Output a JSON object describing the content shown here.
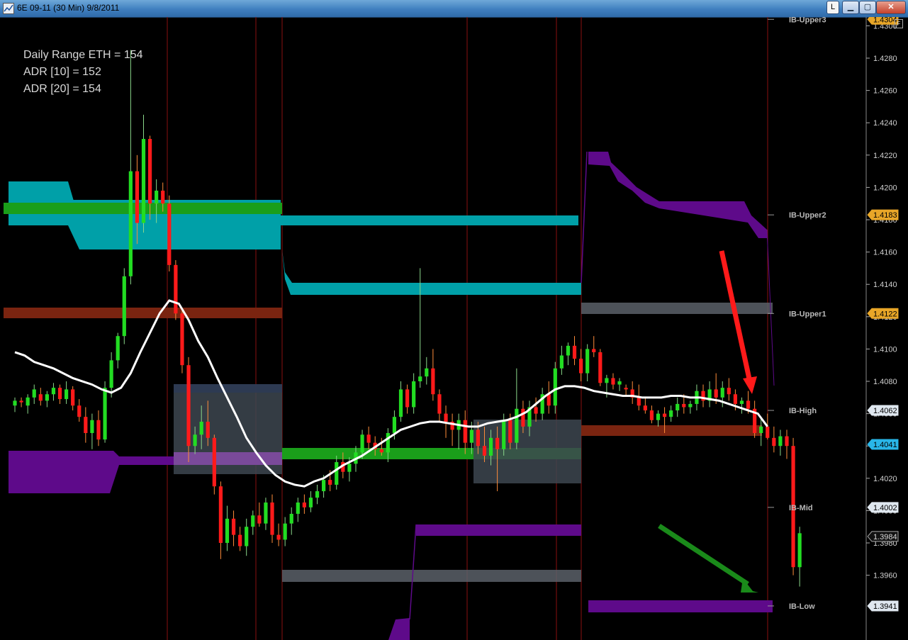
{
  "window": {
    "title": "6E 09-11 (30 Min)  9/8/2011",
    "buttons": {
      "l": "L",
      "minimize": "▁",
      "maximize": "▢",
      "close": "✕"
    },
    "corner_label": "F"
  },
  "stats": {
    "daily_range": "Daily Range ETH = 154",
    "adr10": "ADR [10] = 152",
    "adr20": "ADR [20] = 154"
  },
  "colors": {
    "up_candle": "#22dd22",
    "down_candle": "#ff1a1a",
    "moving_average": "#ffffff",
    "cyan_zone": "#00a0a8",
    "green_zone": "#1a9e1a",
    "brown_zone": "#7a2410",
    "purple_zone": "#5e0a8a",
    "gray_zone": "#5a6068",
    "session_divider": "#8a1010",
    "arrow_down": "#ff1a1a",
    "arrow_up": "#1a8a1a",
    "price_tag_orange": "#e8a628",
    "price_tag_cyan": "#29b6e8",
    "price_tag_white": "#dfe7ef"
  },
  "chart_data": {
    "type": "candlestick",
    "instrument": "6E 09-11",
    "interval": "30 Min",
    "date": "9/8/2011",
    "y_axis": {
      "ticks": [
        "1.4300",
        "1.4280",
        "1.4260",
        "1.4240",
        "1.4220",
        "1.4200",
        "1.4180",
        "1.4160",
        "1.4140",
        "1.4120",
        "1.4100",
        "1.4080",
        "1.4060",
        "1.4040",
        "1.4020",
        "1.4000",
        "1.3980",
        "1.3960"
      ],
      "ylim": [
        1.394,
        1.4312
      ]
    },
    "levels": [
      {
        "name": "IB-Upper3",
        "value": 1.4304,
        "tag": "1.4304",
        "tag_style": "orange"
      },
      {
        "name": "IB-Upper2",
        "value": 1.4183,
        "tag": "1.4183",
        "tag_style": "orange"
      },
      {
        "name": "IB-Upper1",
        "value": 1.4122,
        "tag": "1.4122",
        "tag_style": "orange"
      },
      {
        "name": "IB-High",
        "value": 1.4062,
        "tag": "1.4062",
        "tag_style": "white"
      },
      {
        "name": "IB-Mid",
        "value": 1.4002,
        "tag": "1.4002",
        "tag_style": "white"
      },
      {
        "name": "IB-Low",
        "value": 1.3941,
        "tag": "1.3941",
        "tag_style": "white"
      }
    ],
    "extra_tags": [
      {
        "value": 1.4041,
        "tag": "1.4041",
        "tag_style": "cyan"
      },
      {
        "value": 1.3984,
        "tag": "1.3984",
        "tag_style": "dark"
      }
    ],
    "candles": [
      [
        1.4065,
        1.407,
        1.4061,
        1.4068
      ],
      [
        1.4068,
        1.407,
        1.4064,
        1.4067
      ],
      [
        1.4065,
        1.4072,
        1.406,
        1.407
      ],
      [
        1.407,
        1.4078,
        1.4066,
        1.4075
      ],
      [
        1.4072,
        1.4076,
        1.4065,
        1.4068
      ],
      [
        1.4068,
        1.4074,
        1.4064,
        1.4072
      ],
      [
        1.4072,
        1.4079,
        1.4068,
        1.4076
      ],
      [
        1.4076,
        1.4078,
        1.4066,
        1.4069
      ],
      [
        1.4069,
        1.408,
        1.4066,
        1.4075
      ],
      [
        1.4075,
        1.4077,
        1.4062,
        1.4065
      ],
      [
        1.4065,
        1.4069,
        1.4055,
        1.4058
      ],
      [
        1.4058,
        1.4064,
        1.4042,
        1.4048
      ],
      [
        1.4048,
        1.406,
        1.4038,
        1.4056
      ],
      [
        1.4056,
        1.4062,
        1.404,
        1.4044
      ],
      [
        1.4044,
        1.408,
        1.4042,
        1.4076
      ],
      [
        1.4076,
        1.4098,
        1.407,
        1.4093
      ],
      [
        1.4093,
        1.411,
        1.4088,
        1.4108
      ],
      [
        1.4108,
        1.415,
        1.4103,
        1.4145
      ],
      [
        1.4145,
        1.4285,
        1.414,
        1.421
      ],
      [
        1.421,
        1.422,
        1.4165,
        1.4178
      ],
      [
        1.4178,
        1.4245,
        1.4172,
        1.423
      ],
      [
        1.423,
        1.4232,
        1.418,
        1.419
      ],
      [
        1.419,
        1.4205,
        1.4178,
        1.4198
      ],
      [
        1.4198,
        1.4203,
        1.4185,
        1.419
      ],
      [
        1.419,
        1.4195,
        1.4148,
        1.4152
      ],
      [
        1.4152,
        1.4155,
        1.4118,
        1.4122
      ],
      [
        1.4122,
        1.4125,
        1.4085,
        1.409
      ],
      [
        1.409,
        1.4095,
        1.403,
        1.404
      ],
      [
        1.404,
        1.4052,
        1.4035,
        1.4047
      ],
      [
        1.4047,
        1.4065,
        1.4038,
        1.4055
      ],
      [
        1.4055,
        1.4068,
        1.404,
        1.4045
      ],
      [
        1.4045,
        1.4047,
        1.401,
        1.4015
      ],
      [
        1.4015,
        1.4018,
        1.397,
        1.398
      ],
      [
        1.398,
        1.4003,
        1.3975,
        1.3995
      ],
      [
        1.3995,
        1.4,
        1.3978,
        1.3985
      ],
      [
        1.3985,
        1.399,
        1.3975,
        1.3978
      ],
      [
        1.3978,
        1.3995,
        1.3972,
        1.399
      ],
      [
        1.399,
        1.4,
        1.3985,
        1.3997
      ],
      [
        1.3997,
        1.4005,
        1.399,
        1.3992
      ],
      [
        1.3992,
        1.4008,
        1.3988,
        1.4005
      ],
      [
        1.4005,
        1.401,
        1.398,
        1.3985
      ],
      [
        1.3985,
        1.3992,
        1.3978,
        1.3982
      ],
      [
        1.3982,
        1.3996,
        1.3978,
        1.3992
      ],
      [
        1.3992,
        1.4002,
        1.3985,
        1.3998
      ],
      [
        1.3998,
        1.4008,
        1.3993,
        1.4005
      ],
      [
        1.4005,
        1.401,
        1.3998,
        1.4002
      ],
      [
        1.4002,
        1.4012,
        1.3999,
        1.4008
      ],
      [
        1.4008,
        1.4016,
        1.4004,
        1.4012
      ],
      [
        1.4012,
        1.4022,
        1.4008,
        1.4019
      ],
      [
        1.4019,
        1.4025,
        1.4012,
        1.4016
      ],
      [
        1.4016,
        1.4034,
        1.4013,
        1.403
      ],
      [
        1.403,
        1.4036,
        1.402,
        1.4024
      ],
      [
        1.4024,
        1.4033,
        1.4018,
        1.4029
      ],
      [
        1.4029,
        1.404,
        1.4024,
        1.4036
      ],
      [
        1.4036,
        1.405,
        1.4032,
        1.4047
      ],
      [
        1.4047,
        1.4052,
        1.4038,
        1.4042
      ],
      [
        1.4042,
        1.4046,
        1.4034,
        1.4038
      ],
      [
        1.4038,
        1.4045,
        1.4034,
        1.4036
      ],
      [
        1.4036,
        1.4051,
        1.403,
        1.4048
      ],
      [
        1.4048,
        1.4062,
        1.4044,
        1.4058
      ],
      [
        1.4058,
        1.408,
        1.4055,
        1.4075
      ],
      [
        1.4075,
        1.4078,
        1.406,
        1.4064
      ],
      [
        1.4064,
        1.4085,
        1.406,
        1.408
      ],
      [
        1.408,
        1.415,
        1.4076,
        1.4083
      ],
      [
        1.4083,
        1.4095,
        1.4078,
        1.4088
      ],
      [
        1.4088,
        1.41,
        1.4068,
        1.4072
      ],
      [
        1.4072,
        1.4075,
        1.4055,
        1.406
      ],
      [
        1.406,
        1.4065,
        1.4045,
        1.4055
      ],
      [
        1.4055,
        1.406,
        1.404,
        1.405
      ],
      [
        1.405,
        1.406,
        1.4038,
        1.4056
      ],
      [
        1.4056,
        1.4062,
        1.4035,
        1.4042
      ],
      [
        1.4042,
        1.4055,
        1.4035,
        1.405
      ],
      [
        1.405,
        1.4055,
        1.4035,
        1.404
      ],
      [
        1.404,
        1.4052,
        1.403,
        1.4034
      ],
      [
        1.4034,
        1.405,
        1.4028,
        1.4045
      ],
      [
        1.4045,
        1.4052,
        1.4012,
        1.4038
      ],
      [
        1.4038,
        1.406,
        1.4034,
        1.4056
      ],
      [
        1.4056,
        1.406,
        1.4038,
        1.4042
      ],
      [
        1.4042,
        1.4088,
        1.4038,
        1.4063
      ],
      [
        1.4063,
        1.4068,
        1.4048,
        1.4052
      ],
      [
        1.4052,
        1.4068,
        1.4046,
        1.4064
      ],
      [
        1.4064,
        1.407,
        1.4055,
        1.406
      ],
      [
        1.406,
        1.4076,
        1.4056,
        1.4072
      ],
      [
        1.4072,
        1.408,
        1.406,
        1.4065
      ],
      [
        1.4065,
        1.4092,
        1.406,
        1.4088
      ],
      [
        1.4088,
        1.4102,
        1.4084,
        1.4096
      ],
      [
        1.4096,
        1.4104,
        1.409,
        1.4102
      ],
      [
        1.4102,
        1.4108,
        1.409,
        1.4094
      ],
      [
        1.4094,
        1.41,
        1.408,
        1.4085
      ],
      [
        1.4085,
        1.4103,
        1.408,
        1.41
      ],
      [
        1.41,
        1.4108,
        1.4095,
        1.4098
      ],
      [
        1.4098,
        1.41,
        1.4077,
        1.4079
      ],
      [
        1.4079,
        1.4084,
        1.407,
        1.4082
      ],
      [
        1.4082,
        1.4085,
        1.4075,
        1.4078
      ],
      [
        1.4078,
        1.4082,
        1.4074,
        1.408
      ],
      [
        1.4076,
        1.4078,
        1.4071,
        1.4075
      ],
      [
        1.4075,
        1.408,
        1.4066,
        1.407
      ],
      [
        1.407,
        1.4078,
        1.4062,
        1.4065
      ],
      [
        1.4065,
        1.407,
        1.406,
        1.4062
      ],
      [
        1.4062,
        1.4065,
        1.4054,
        1.4056
      ],
      [
        1.4056,
        1.4062,
        1.4052,
        1.406
      ],
      [
        1.406,
        1.4064,
        1.4048,
        1.4058
      ],
      [
        1.4058,
        1.4065,
        1.4055,
        1.4062
      ],
      [
        1.4062,
        1.407,
        1.4058,
        1.4066
      ],
      [
        1.4066,
        1.4072,
        1.406,
        1.4064
      ],
      [
        1.4064,
        1.4068,
        1.406,
        1.4066
      ],
      [
        1.4066,
        1.4078,
        1.4062,
        1.4074
      ],
      [
        1.4074,
        1.4078,
        1.4064,
        1.4068
      ],
      [
        1.4068,
        1.408,
        1.4064,
        1.4075
      ],
      [
        1.4075,
        1.4085,
        1.4066,
        1.407
      ],
      [
        1.407,
        1.408,
        1.4064,
        1.4076
      ],
      [
        1.4076,
        1.4082,
        1.4068,
        1.4072
      ],
      [
        1.4072,
        1.4075,
        1.4062,
        1.4066
      ],
      [
        1.4066,
        1.407,
        1.406,
        1.4068
      ],
      [
        1.4068,
        1.4074,
        1.406,
        1.4063
      ],
      [
        1.4063,
        1.4068,
        1.4045,
        1.4048
      ],
      [
        1.4048,
        1.4058,
        1.404,
        1.4052
      ],
      [
        1.4052,
        1.406,
        1.4044,
        1.4045
      ],
      [
        1.4045,
        1.4052,
        1.4036,
        1.404
      ],
      [
        1.404,
        1.405,
        1.4034,
        1.4046
      ],
      [
        1.4046,
        1.405,
        1.4032,
        1.404
      ],
      [
        1.404,
        1.4045,
        1.396,
        1.3965
      ],
      [
        1.3965,
        1.399,
        1.3953,
        1.3986
      ]
    ],
    "moving_average": [
      1.4098,
      1.4096,
      1.4092,
      1.409,
      1.4088,
      1.4085,
      1.4082,
      1.408,
      1.4078,
      1.4075,
      1.4073,
      1.4076,
      1.4085,
      1.4098,
      1.411,
      1.4122,
      1.413,
      1.4128,
      1.4118,
      1.4105,
      1.4095,
      1.4082,
      1.407,
      1.4058,
      1.4045,
      1.4036,
      1.4028,
      1.4022,
      1.4018,
      1.4016,
      1.4015,
      1.4018,
      1.402,
      1.4024,
      1.4028,
      1.4031,
      1.4034,
      1.4038,
      1.4042,
      1.4046,
      1.405,
      1.4052,
      1.4054,
      1.4055,
      1.4055,
      1.4054,
      1.4053,
      1.4052,
      1.4052,
      1.4054,
      1.4055,
      1.4056,
      1.4058,
      1.4061,
      1.4066,
      1.4071,
      1.4075,
      1.4077,
      1.4077,
      1.4076,
      1.4074,
      1.4073,
      1.4072,
      1.4071,
      1.4071,
      1.407,
      1.407,
      1.407,
      1.4071,
      1.4071,
      1.407,
      1.407,
      1.4069,
      1.4068,
      1.4066,
      1.4064,
      1.4062,
      1.406,
      1.4052
    ],
    "annotations": [
      "Daily Range ETH = 154",
      "ADR [10] = 152",
      "ADR [20] = 154"
    ]
  }
}
